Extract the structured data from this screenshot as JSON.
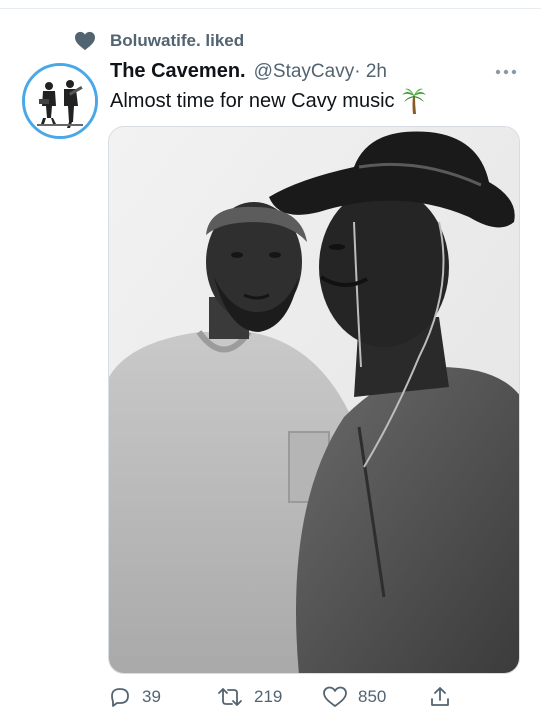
{
  "social_context": {
    "icon": "heart-icon",
    "text": "Boluwatife. liked"
  },
  "tweet": {
    "author": {
      "display_name": "The Cavemen.",
      "handle": "@StayCavy",
      "time": " · 2h",
      "avatar": "band-avatar"
    },
    "text": "Almost time for new Cavy music",
    "emoji": "palm-tree-icon",
    "media": {
      "kind": "photo",
      "description_icon": "photo-two-people"
    },
    "actions": {
      "replies": "39",
      "retweets": "219",
      "likes": "850"
    }
  },
  "colors": {
    "secondary_text": "#536471",
    "primary_text": "#0f1419",
    "avatar_ring": "#4aa8e8",
    "divider": "#e6ecf0"
  }
}
